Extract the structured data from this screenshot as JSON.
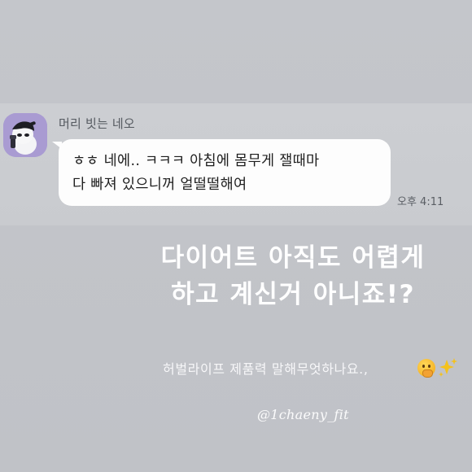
{
  "chat": {
    "sender_name": "머리 빗는 네오",
    "message": "ㅎㅎ 네에.. ㅋㅋㅋ 아침에 몸무게 잴때마\n다 빠져 있으니꺼 얼떨떨해여",
    "time": "오후 4:11"
  },
  "story": {
    "headline": "다이어트 아직도 어렵게\n하고 계신거 아니죠!?",
    "caption": "허벌라이프 제품력 말해무엇하나요.,",
    "handle": "@1chaeny_fit"
  },
  "icons": {
    "avatar": "neo-character-avatar",
    "emoji_1": "shushing-face-emoji",
    "emoji_2": "sparkles-emoji"
  },
  "colors": {
    "background": "#c3c5ca",
    "bubble": "#fdfdfd",
    "headline_text": "#ffffff",
    "avatar_bg": "#a99bd2"
  }
}
